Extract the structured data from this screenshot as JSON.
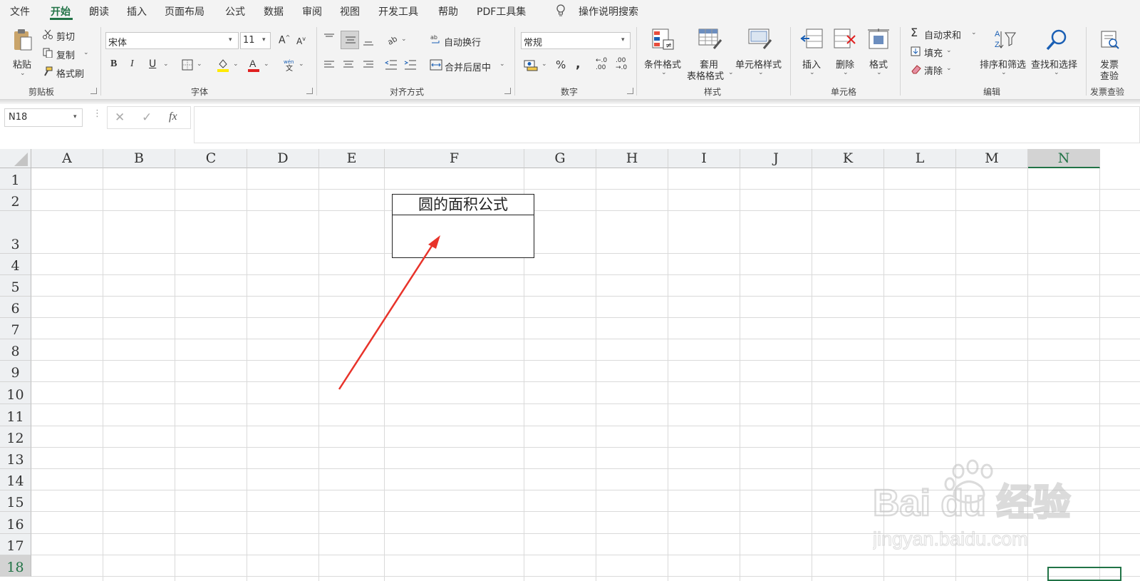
{
  "menu": {
    "file": "文件",
    "home": "开始",
    "read": "朗读",
    "insert": "插入",
    "page_layout": "页面布局",
    "formulas": "公式",
    "data": "数据",
    "review": "审阅",
    "view": "视图",
    "developer": "开发工具",
    "help": "帮助",
    "pdf": "PDF工具集",
    "tell_me": "操作说明搜索"
  },
  "ribbon": {
    "clipboard": {
      "paste": "粘贴",
      "cut": "剪切",
      "copy": "复制",
      "format_painter": "格式刷",
      "label": "剪贴板"
    },
    "font": {
      "name": "宋体",
      "size": "11",
      "bold": "B",
      "italic": "I",
      "underline": "U",
      "label": "字体"
    },
    "alignment": {
      "wrap": "自动换行",
      "merge": "合并后居中",
      "label": "对齐方式"
    },
    "number": {
      "format": "常规",
      "label": "数字"
    },
    "styles": {
      "conditional": "条件格式",
      "table_1": "套用",
      "table_2": "表格格式",
      "cell_styles": "单元格样式",
      "label": "样式"
    },
    "cells": {
      "insert": "插入",
      "delete": "删除",
      "format": "格式",
      "label": "单元格"
    },
    "editing": {
      "autosum": "自动求和",
      "fill": "填充",
      "clear": "清除",
      "sort": "排序和筛选",
      "find": "查找和选择",
      "label": "编辑"
    },
    "invoice": {
      "btn_1": "发票",
      "btn_2": "查验",
      "label": "发票查验"
    }
  },
  "formula_bar": {
    "name_box": "N18",
    "fx": "fx",
    "value": ""
  },
  "sheet": {
    "columns": [
      "A",
      "B",
      "C",
      "D",
      "E",
      "F",
      "G",
      "H",
      "I",
      "J",
      "K",
      "L",
      "M",
      "N"
    ],
    "selected_column": "N",
    "rows": [
      "1",
      "2",
      "3",
      "4",
      "5",
      "6",
      "7",
      "8",
      "9",
      "10",
      "11",
      "12",
      "13",
      "14",
      "15",
      "16",
      "17",
      "18"
    ],
    "cells": {
      "F2": "圆的面积公式",
      "F3": ""
    },
    "selected_cell": "N18"
  },
  "watermark": {
    "brand": "Bai du 经验",
    "url": "jingyan.baidu.com"
  },
  "colors": {
    "accent": "#217346",
    "arrow": "#e8332a",
    "font_color": "#e02020",
    "fill_color": "#ffea00"
  },
  "icons": [
    "paste-icon",
    "cut-icon",
    "copy-icon",
    "format-painter-icon",
    "bold-icon",
    "italic-icon",
    "underline-icon",
    "border-icon",
    "fill-color-icon",
    "font-color-icon",
    "phonetic-icon",
    "wrap-text-icon",
    "merge-icon",
    "currency-icon",
    "percent-icon",
    "comma-icon",
    "conditional-format-icon",
    "table-format-icon",
    "cell-styles-icon",
    "insert-cells-icon",
    "delete-cells-icon",
    "format-cells-icon",
    "sum-icon",
    "fill-icon",
    "clear-icon",
    "sort-filter-icon",
    "find-icon",
    "invoice-check-icon",
    "lightbulb-icon",
    "function-icon"
  ]
}
